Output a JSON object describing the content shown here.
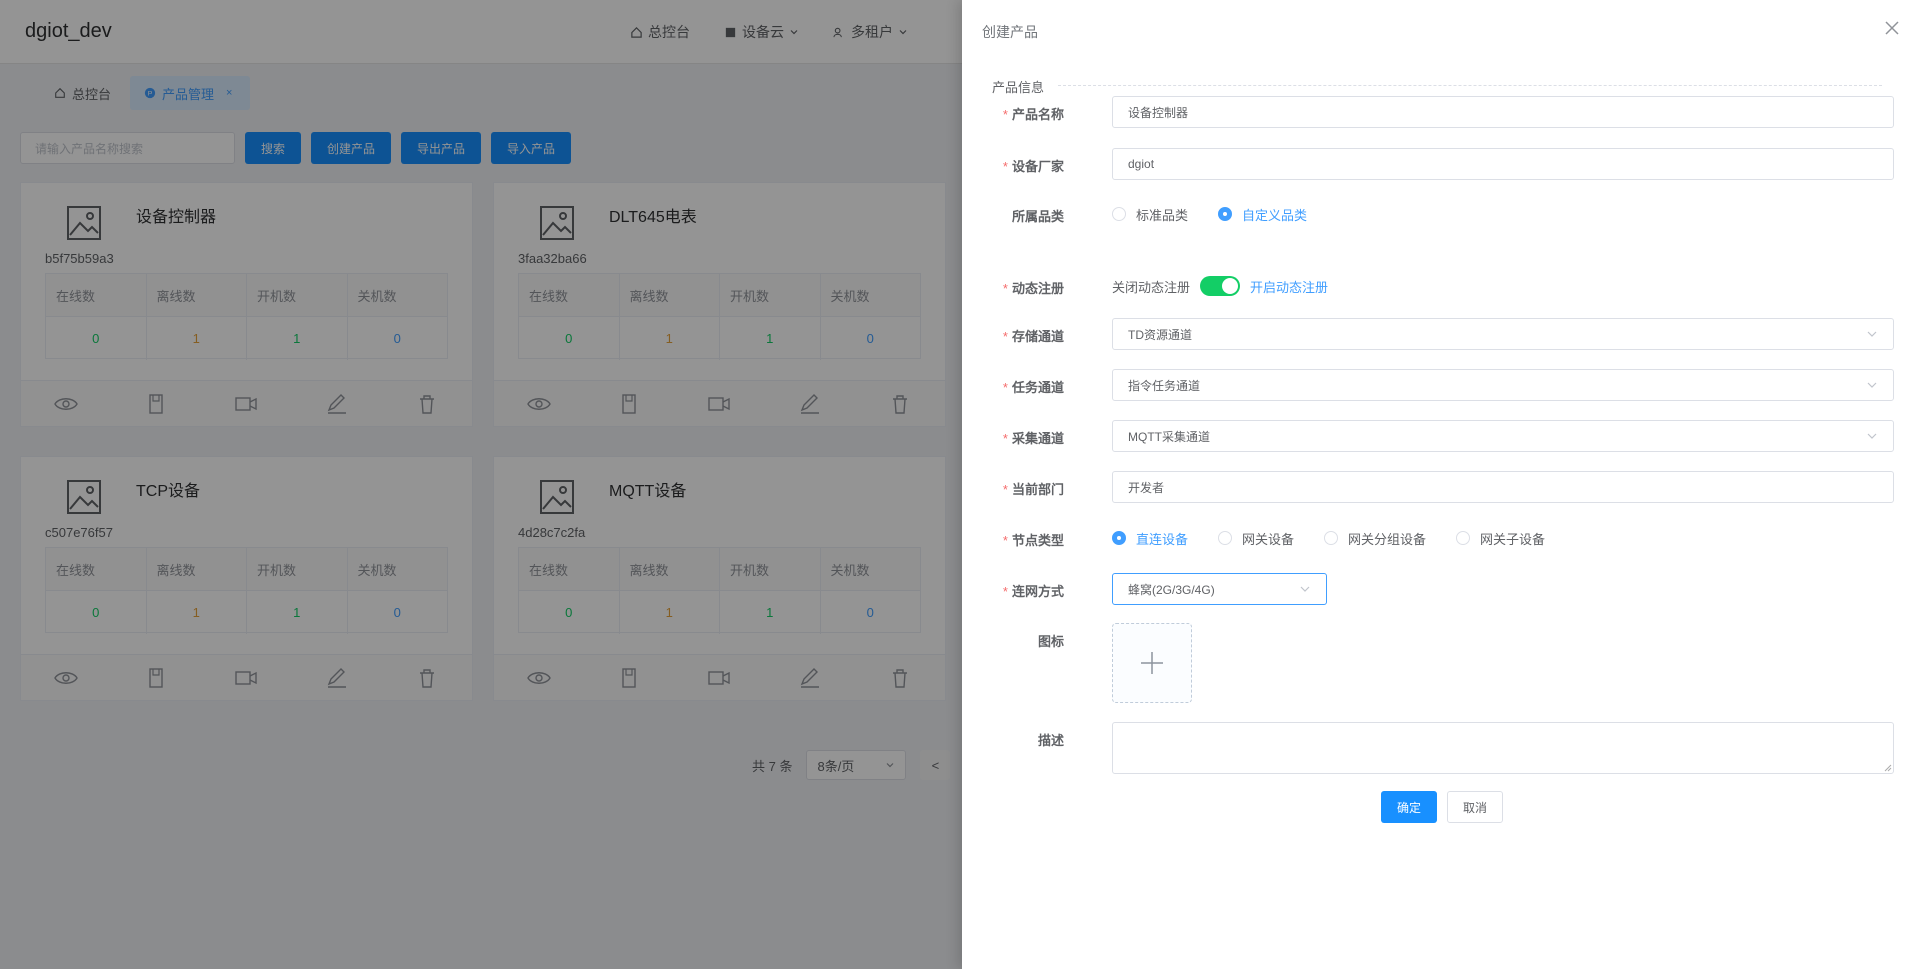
{
  "app": {
    "brand": "dgiot_dev",
    "nav": [
      {
        "label": "总控台",
        "icon": "home-icon"
      },
      {
        "label": "设备云",
        "icon": "device-icon"
      },
      {
        "label": "多租户",
        "icon": "users-icon"
      }
    ],
    "tabs": [
      {
        "label": "总控台",
        "icon": "home-icon"
      },
      {
        "label": "产品管理",
        "icon": "product-icon",
        "close": "×"
      }
    ],
    "search_placeholder": "请输入产品名称搜索",
    "buttons": {
      "search": "搜索",
      "create": "创建产品",
      "export": "导出产品",
      "import": "导入产品"
    },
    "stat_headers": [
      "在线数",
      "离线数",
      "开机数",
      "关机数"
    ],
    "stat_colors": [
      "#13ce66",
      "#e6a23c",
      "#13ce66",
      "#409eff"
    ],
    "cards": [
      {
        "name": "设备控制器",
        "id": "b5f75b59a3",
        "stats": [
          "0",
          "1",
          "1",
          "0"
        ]
      },
      {
        "name": "DLT645电表",
        "id": "3faa32ba66",
        "stats": [
          "0",
          "1",
          "1",
          "0"
        ]
      },
      {
        "name": "TCP设备",
        "id": "c507e76f57",
        "stats": [
          "0",
          "1",
          "1",
          "0"
        ]
      },
      {
        "name": "MQTT设备",
        "id": "4d28c7c2fa",
        "stats": [
          "0",
          "1",
          "1",
          "0"
        ]
      }
    ],
    "pager": {
      "total": "共 7 条",
      "page_size": "8条/页",
      "prev": "<"
    }
  },
  "drawer": {
    "title": "创建产品",
    "section": "产品信息",
    "fields": {
      "name": {
        "label": "产品名称",
        "value": "设备控制器"
      },
      "vendor": {
        "label": "设备厂家",
        "value": "dgiot"
      },
      "category": {
        "label": "所属品类",
        "options": [
          "标准品类",
          "自定义品类"
        ],
        "selected": "自定义品类"
      },
      "dynamic_reg": {
        "label": "动态注册",
        "off_text": "关闭动态注册",
        "on_text": "开启动态注册"
      },
      "storage": {
        "label": "存储通道",
        "value": "TD资源通道"
      },
      "task": {
        "label": "任务通道",
        "value": "指令任务通道"
      },
      "collect": {
        "label": "采集通道",
        "value": "MQTT采集通道"
      },
      "department": {
        "label": "当前部门",
        "value": "开发者"
      },
      "node_type": {
        "label": "节点类型",
        "options": [
          "直连设备",
          "网关设备",
          "网关分组设备",
          "网关子设备"
        ],
        "selected": "直连设备"
      },
      "network": {
        "label": "连网方式",
        "value": "蜂窝(2G/3G/4G)"
      },
      "icon": {
        "label": "图标"
      },
      "description": {
        "label": "描述",
        "value": ""
      }
    },
    "confirm": "确定",
    "cancel": "取消"
  }
}
